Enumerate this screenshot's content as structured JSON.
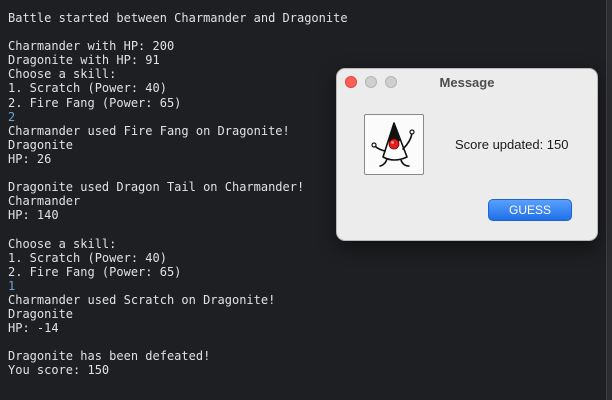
{
  "console": {
    "lines": [
      {
        "text": "Battle started between Charmander and Dragonite",
        "type": "out"
      },
      {
        "text": "",
        "type": "out"
      },
      {
        "text": "Charmander with HP: 200",
        "type": "out"
      },
      {
        "text": "Dragonite with HP: 91",
        "type": "out"
      },
      {
        "text": "Choose a skill:",
        "type": "out"
      },
      {
        "text": "1. Scratch (Power: 40)",
        "type": "out"
      },
      {
        "text": "2. Fire Fang (Power: 65)",
        "type": "out"
      },
      {
        "text": "2",
        "type": "input"
      },
      {
        "text": "Charmander used Fire Fang on Dragonite!",
        "type": "out"
      },
      {
        "text": "Dragonite",
        "type": "out"
      },
      {
        "text": "HP: 26",
        "type": "out"
      },
      {
        "text": "",
        "type": "out"
      },
      {
        "text": "Dragonite used Dragon Tail on Charmander!",
        "type": "out"
      },
      {
        "text": "Charmander",
        "type": "out"
      },
      {
        "text": "HP: 140",
        "type": "out"
      },
      {
        "text": "",
        "type": "out"
      },
      {
        "text": "Choose a skill:",
        "type": "out"
      },
      {
        "text": "1. Scratch (Power: 40)",
        "type": "out"
      },
      {
        "text": "2. Fire Fang (Power: 65)",
        "type": "out"
      },
      {
        "text": "1",
        "type": "input"
      },
      {
        "text": "Charmander used Scratch on Dragonite!",
        "type": "out"
      },
      {
        "text": "Dragonite",
        "type": "out"
      },
      {
        "text": "HP: -14",
        "type": "out"
      },
      {
        "text": "",
        "type": "out"
      },
      {
        "text": "Dragonite has been defeated!",
        "type": "out"
      },
      {
        "text": "You score: 150",
        "type": "out"
      }
    ],
    "colors": {
      "background": "#1e1f22",
      "text": "#dfe1e5",
      "input": "#6aa4dc"
    }
  },
  "dialog": {
    "title": "Message",
    "message": "Score updated: 150",
    "button_label": "GUESS",
    "icon": "java-duke-icon"
  }
}
